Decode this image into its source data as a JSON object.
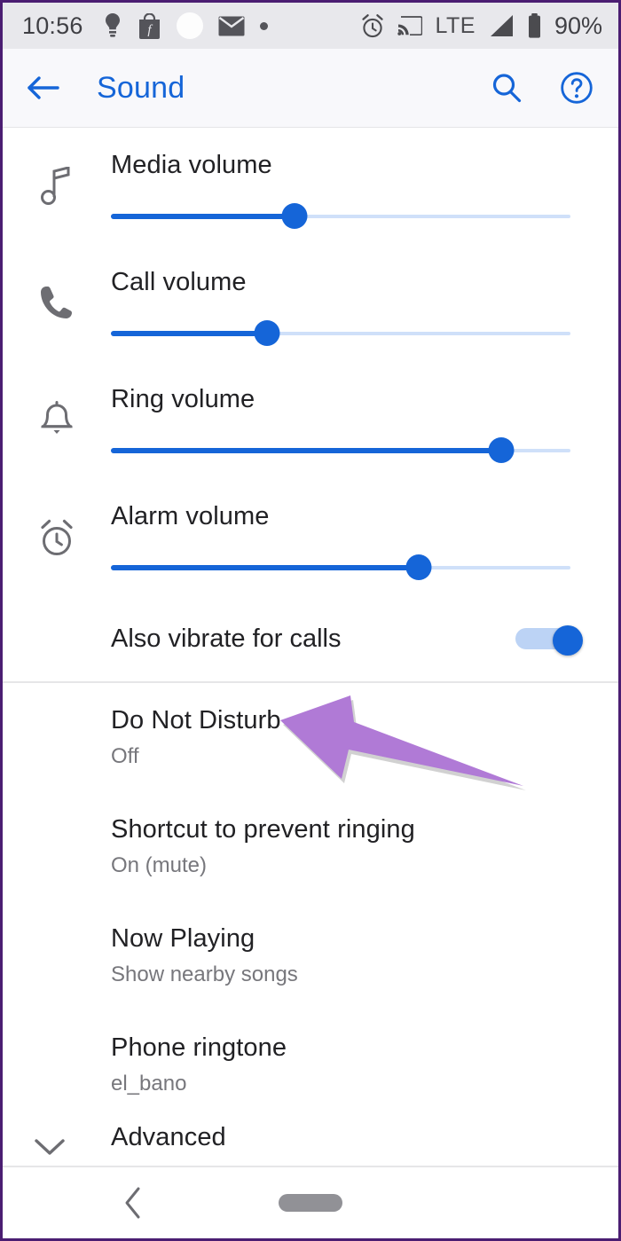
{
  "status_bar": {
    "time": "10:56",
    "left_icons": [
      "lightbulb-tip-icon",
      "shopping-bag-f-icon",
      "white-circle-icon",
      "envelope-mail-icon",
      "small-dot-icon"
    ],
    "network_label": "LTE",
    "battery_percent": "90%",
    "right_icons": [
      "alarm-clock-icon",
      "cast-icon",
      "signal-bars-icon",
      "battery-icon"
    ]
  },
  "toolbar": {
    "title": "Sound",
    "back_icon": "arrow-back-icon",
    "search_icon": "search-icon",
    "help_icon": "help-circle-icon",
    "accent_color": "#1565d8"
  },
  "volume_sliders": [
    {
      "icon": "music-note-icon",
      "label": "Media volume",
      "value": 40
    },
    {
      "icon": "phone-call-icon",
      "label": "Call volume",
      "value": 34
    },
    {
      "icon": "bell-ring-icon",
      "label": "Ring volume",
      "value": 85
    },
    {
      "icon": "alarm-clock-icon",
      "label": "Alarm volume",
      "value": 67
    }
  ],
  "vibrate_row": {
    "label": "Also vibrate for calls",
    "toggle_state": "on"
  },
  "settings_items": [
    {
      "title": "Do Not Disturb",
      "subtitle": "Off"
    },
    {
      "title": "Shortcut to prevent ringing",
      "subtitle": "On (mute)"
    },
    {
      "title": "Now Playing",
      "subtitle": "Show nearby songs"
    },
    {
      "title": "Phone ringtone",
      "subtitle": "el_bano"
    }
  ],
  "advanced": {
    "label": "Advanced",
    "icon": "chevron-down-icon"
  },
  "navigation_bar": {
    "back_icon": "chevron-back-icon",
    "home_pill": "home-pill-indicator"
  },
  "annotation": {
    "type": "arrow",
    "color": "#b07ad6",
    "points_at": "Do Not Disturb"
  }
}
